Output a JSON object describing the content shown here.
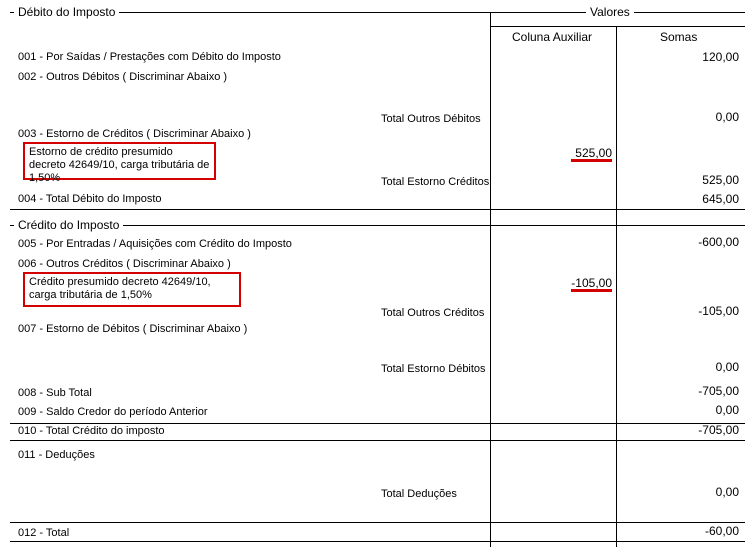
{
  "header": {
    "debito_title": "Débito do Imposto",
    "valores": "Valores",
    "coluna_auxiliar": "Coluna Auxiliar",
    "somas": "Somas"
  },
  "debito": {
    "r001_label": "001 - Por Saídas / Prestações com Débito do Imposto",
    "r001_soma": "120,00",
    "r002_label": "002 - Outros Débitos ( Discriminar Abaixo )",
    "total_outros_debitos_label": "Total Outros Débitos",
    "total_outros_debitos_soma": "0,00",
    "r003_label": "003 - Estorno de Créditos ( Discriminar Abaixo )",
    "estorno_detail": "Estorno de crédito presumido decreto 42649/10, carga tributária de 1,50%",
    "estorno_aux": "525,00",
    "total_estorno_creditos_label": "Total Estorno Créditos",
    "total_estorno_creditos_soma": "525,00",
    "r004_label": "004 - Total Débito do Imposto",
    "r004_soma": "645,00"
  },
  "credito": {
    "title": "Crédito do Imposto",
    "r005_label": "005 - Por Entradas / Aquisições com Crédito do Imposto",
    "r005_soma": "-600,00",
    "r006_label": "006 - Outros Créditos ( Discriminar Abaixo )",
    "outros_detail": "Crédito presumido decreto 42649/10, carga tributária de 1,50%",
    "outros_aux": "-105,00",
    "total_outros_creditos_label": "Total Outros Créditos",
    "total_outros_creditos_soma": "-105,00",
    "r007_label": "007 - Estorno de Débitos ( Discriminar Abaixo )",
    "total_estorno_debitos_label": "Total Estorno Débitos",
    "total_estorno_debitos_soma": "0,00",
    "r008_label": "008 - Sub Total",
    "r008_soma": "-705,00",
    "r009_label": "009 - Saldo Credor do período Anterior",
    "r009_soma": "0,00",
    "r010_label": "010 - Total Crédito do imposto",
    "r010_soma": "-705,00",
    "r011_label": "011 - Deduções",
    "total_deducoes_label": "Total Deduções",
    "total_deducoes_soma": "0,00",
    "r012_label": "012 - Total",
    "r012_soma": "-60,00"
  },
  "colors": {
    "highlight": "#d40000"
  }
}
